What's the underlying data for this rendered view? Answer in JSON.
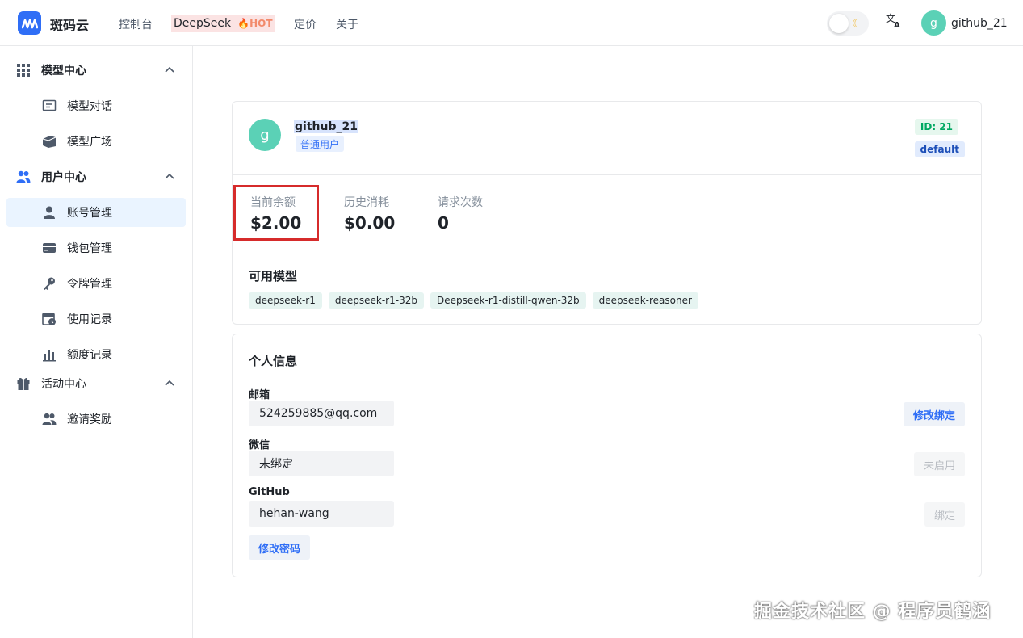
{
  "app": {
    "brand": "斑码云"
  },
  "nav": {
    "console": "控制台",
    "deepseek": "DeepSeek",
    "hot": "HOT",
    "pricing": "定价",
    "about": "关于"
  },
  "header_user": {
    "avatar_letter": "g",
    "name": "github_21"
  },
  "sidebar": {
    "groups": [
      {
        "label": "模型中心",
        "items": [
          {
            "label": "模型对话"
          },
          {
            "label": "模型广场"
          }
        ]
      },
      {
        "label": "用户中心",
        "items": [
          {
            "label": "账号管理"
          },
          {
            "label": "钱包管理"
          },
          {
            "label": "令牌管理"
          },
          {
            "label": "使用记录"
          },
          {
            "label": "额度记录"
          }
        ]
      },
      {
        "label": "活动中心",
        "items": [
          {
            "label": "邀请奖励"
          }
        ]
      }
    ]
  },
  "profile": {
    "avatar_letter": "g",
    "username": "github_21",
    "role": "普通用户",
    "id_tag": "ID: 21",
    "group_tag": "default"
  },
  "stats": {
    "balance": {
      "label": "当前余额",
      "value": "$2.00"
    },
    "history": {
      "label": "历史消耗",
      "value": "$0.00"
    },
    "requests": {
      "label": "请求次数",
      "value": "0"
    }
  },
  "models": {
    "title": "可用模型",
    "items": [
      "deepseek-r1",
      "deepseek-r1-32b",
      "Deepseek-r1-distill-qwen-32b",
      "deepseek-reasoner"
    ]
  },
  "personal": {
    "title": "个人信息",
    "email": {
      "label": "邮箱",
      "value": "524259885@qq.com",
      "button": "修改绑定"
    },
    "wechat": {
      "label": "微信",
      "value": "未绑定",
      "button": "未启用"
    },
    "github": {
      "label": "GitHub",
      "value": "hehan-wang",
      "button": "绑定"
    },
    "change_password": "修改密码"
  },
  "watermark": "掘金技术社区 @ 程序员鹤涵",
  "colors": {
    "accent": "#2f6ef6",
    "avatar": "#5bd1b6",
    "highlight": "#d62b2b"
  }
}
